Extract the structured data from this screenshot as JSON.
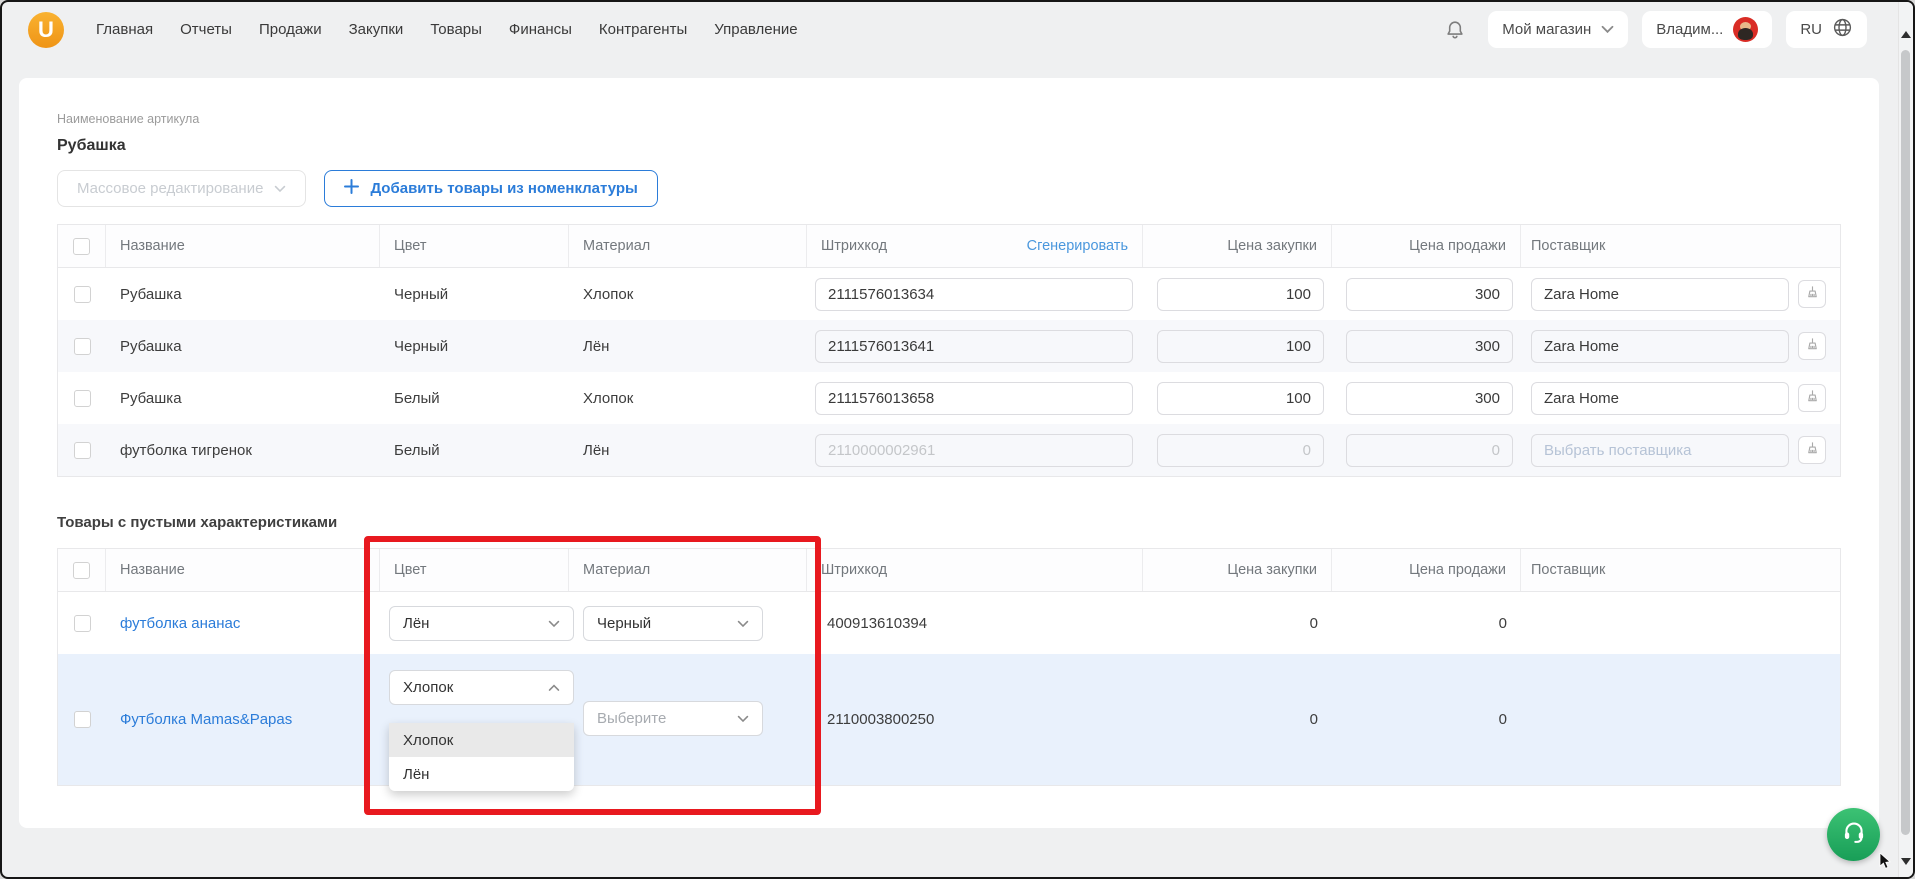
{
  "topbar": {
    "brand": "U",
    "menu": [
      "Главная",
      "Отчеты",
      "Продажи",
      "Закупки",
      "Товары",
      "Финансы",
      "Контрагенты",
      "Управление"
    ],
    "store_selector_label": "Мой магазин",
    "user_label": "Владим...",
    "language_label": "RU"
  },
  "toolbar": {
    "article_label": "Наименование артикула",
    "article_value": "Рубашка",
    "bulk_edit_label": "Массовое редактирование",
    "add_products_label": "Добавить товары из номенклатуры"
  },
  "table1": {
    "headers": {
      "name": "Название",
      "color": "Цвет",
      "material": "Материал",
      "barcode": "Штрихкод",
      "generate": "Сгенерировать",
      "purchase": "Цена закупки",
      "sale": "Цена продажи",
      "supplier": "Поставщик"
    },
    "rows": [
      {
        "name": "Рубашка",
        "color": "Черный",
        "material": "Хлопок",
        "barcode": "2111576013634",
        "purchase": "100",
        "sale": "300",
        "supplier": "Zara Home"
      },
      {
        "name": "Рубашка",
        "color": "Черный",
        "material": "Лён",
        "barcode": "2111576013641",
        "purchase": "100",
        "sale": "300",
        "supplier": "Zara Home"
      },
      {
        "name": "Рубашка",
        "color": "Белый",
        "material": "Хлопок",
        "barcode": "2111576013658",
        "purchase": "100",
        "sale": "300",
        "supplier": "Zara Home"
      },
      {
        "name": "футболка тигренок",
        "color": "Белый",
        "material": "Лён",
        "barcode": "2110000002961",
        "purchase": "0",
        "sale": "0",
        "supplier_placeholder": "Выбрать поставщика"
      }
    ]
  },
  "empty_section": {
    "title": "Товары с пустыми характеристиками",
    "headers": {
      "name": "Название",
      "color": "Цвет",
      "material": "Материал",
      "barcode": "Штрихкод",
      "purchase": "Цена закупки",
      "sale": "Цена продажи",
      "supplier": "Поставщик"
    },
    "rows": [
      {
        "name": "футболка ананас",
        "color": "Лён",
        "material": "Черный",
        "barcode": "400913610394",
        "purchase": "0",
        "sale": "0"
      },
      {
        "name": "Футболка Mamas&Papas",
        "color": "Хлопок",
        "material_placeholder": "Выберите",
        "barcode": "2110003800250",
        "purchase": "0",
        "sale": "0",
        "color_options": [
          "Хлопок",
          "Лён"
        ]
      }
    ]
  },
  "colors": {
    "logo_orange": "#f5a31c",
    "accent_blue": "#2b7cd9",
    "link_blue": "#4a97dd",
    "annotation_red": "#e8191f",
    "support_green": "#25b56c",
    "row_alt": "#f7f8fb",
    "row_active": "#e9f1fc"
  }
}
